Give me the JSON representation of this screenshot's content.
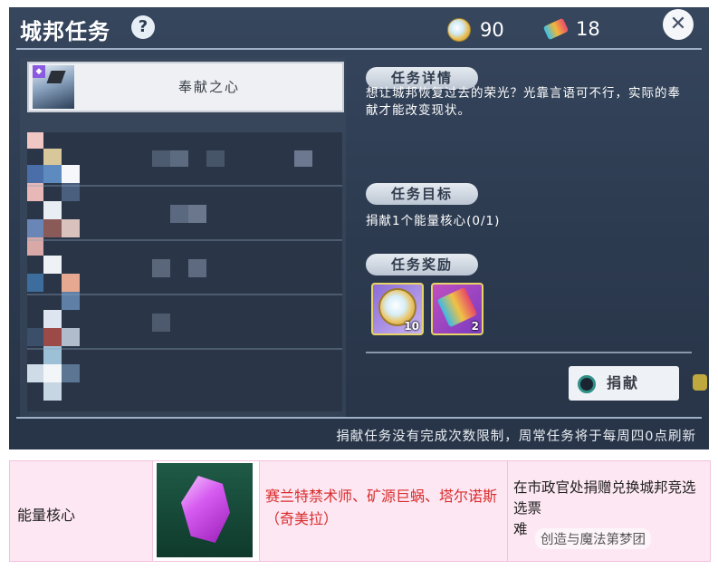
{
  "header": {
    "title": "城邦任务",
    "help_icon": "?",
    "currency_coin": "90",
    "currency_ticket": "18",
    "close_icon": "✕"
  },
  "task_list": {
    "selected_task": "奉献之心",
    "badge": "◆"
  },
  "details": {
    "detail_label": "任务详情",
    "description": "想让城邦恢复过去的荣光？光靠言语可不行，实际的奉献才能改变现状。",
    "goal_label": "任务目标",
    "goal_text": "捐献1个能量核心(0/1)",
    "reward_label": "任务奖励",
    "rewards": [
      {
        "icon": "coin-icon",
        "count": "10"
      },
      {
        "icon": "ticket-icon",
        "count": "2"
      }
    ],
    "donate_button": "捐献"
  },
  "footer_text": "捐献任务没有完成次数限制，周常任务将于每周四0点刷新",
  "table": {
    "item_name": "能量核心",
    "item_icon": "crystal-icon",
    "sources": "赛兰特禁术师、矿源巨蜗、塔尔诺斯（奇美拉）",
    "usage": "在市政官处捐赠兑换城邦竞选选票",
    "usage_line2": "难",
    "watermark": "创造与魔法第梦团"
  },
  "colors": {
    "panel_bg": "#2c3a4f",
    "accent_red": "#d92d2d",
    "table_bg": "#fde7f2"
  }
}
